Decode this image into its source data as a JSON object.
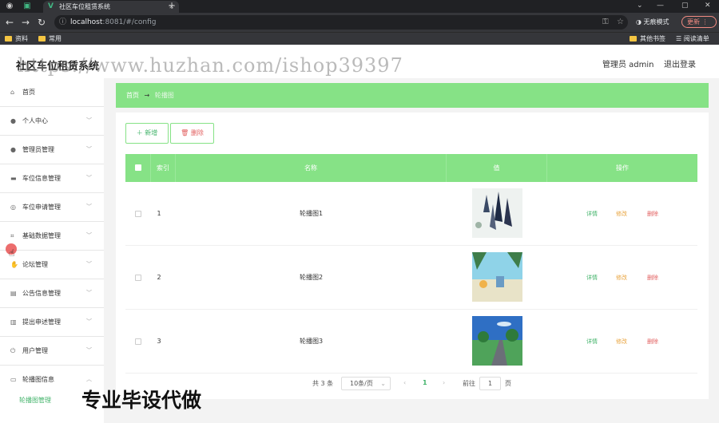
{
  "browser": {
    "tab_title": "社区车位租赁系统",
    "url_host": "localhost",
    "url_path": ":8081/#/config",
    "incognito_label": "无痕模式",
    "update_label": "更新",
    "bookmarks": [
      "资料",
      "常用"
    ],
    "bookmarks_right": [
      "其他书签",
      "阅读清单"
    ]
  },
  "header": {
    "title": "社区车位租赁系统",
    "admin": "管理员 admin",
    "logout": "退出登录",
    "watermark": "https://www.huzhan.com/ishop39397"
  },
  "sidebar": {
    "items": [
      {
        "label": "首页",
        "icon": "home-icon",
        "expandable": false
      },
      {
        "label": "个人中心",
        "icon": "user-icon",
        "expandable": true
      },
      {
        "label": "管理员管理",
        "icon": "user-icon",
        "expandable": true
      },
      {
        "label": "车位信息管理",
        "icon": "monitor-icon",
        "expandable": true
      },
      {
        "label": "车位申请管理",
        "icon": "compass-icon",
        "expandable": true
      },
      {
        "label": "基础数据管理",
        "icon": "crop-icon",
        "expandable": true
      },
      {
        "label": "论坛管理",
        "icon": "hand-icon",
        "expandable": true
      },
      {
        "label": "公告信息管理",
        "icon": "message-icon",
        "expandable": true
      },
      {
        "label": "提出申述管理",
        "icon": "clipboard-icon",
        "expandable": true
      },
      {
        "label": "用户管理",
        "icon": "power-icon",
        "expandable": true
      },
      {
        "label": "轮播图信息",
        "icon": "chat-icon",
        "expandable": true
      }
    ],
    "sub_item": "轮播图管理"
  },
  "breadcrumb": {
    "home": "首页",
    "current": "轮播图"
  },
  "toolbar": {
    "add_label": "新增",
    "delete_label": "删除"
  },
  "table": {
    "columns": [
      "索引",
      "名称",
      "值",
      "操作"
    ],
    "rows": [
      {
        "index": "1",
        "name": "轮播图1"
      },
      {
        "index": "2",
        "name": "轮播图2"
      },
      {
        "index": "3",
        "name": "轮播图3"
      }
    ],
    "actions": {
      "view": "详情",
      "edit": "修改",
      "delete": "删除"
    }
  },
  "pagination": {
    "total": "共 3 条",
    "page_size": "10条/页",
    "current_page": "1",
    "goto_label": "前往",
    "goto_value": "1",
    "page_suffix": "页"
  },
  "overlay_text": "专业毕设代做",
  "colors": {
    "accent_green": "#86e286",
    "link_green": "#42b36a",
    "edit_orange": "#e8a33d",
    "delete_red": "#e26060"
  }
}
